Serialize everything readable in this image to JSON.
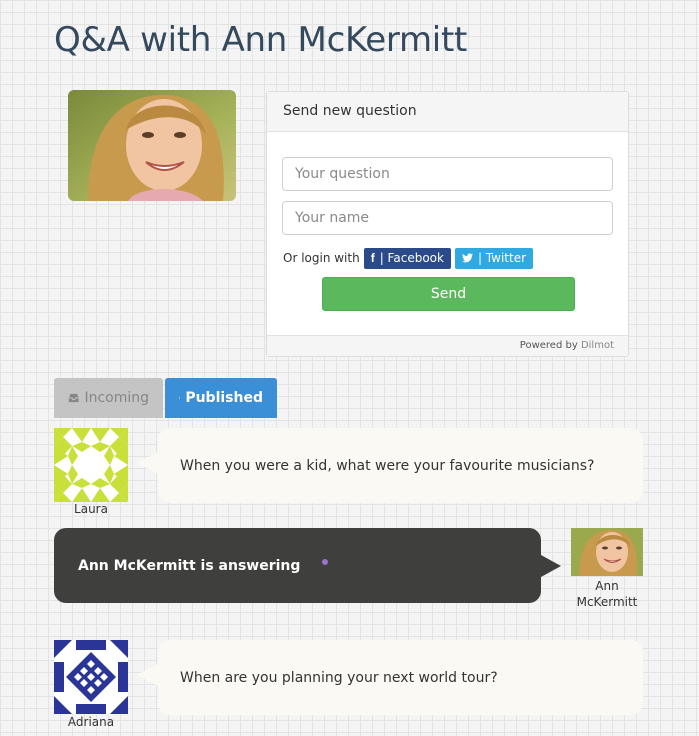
{
  "page": {
    "title": "Q&A with Ann McKermitt"
  },
  "form": {
    "header": "Send new question",
    "question_placeholder": "Your question",
    "name_placeholder": "Your name",
    "login_prefix": "Or login with",
    "facebook_label": "| Facebook",
    "twitter_label": "| Twitter",
    "send_label": "Send",
    "footer_prefix": "Powered by",
    "footer_brand": "Dilmot"
  },
  "tabs": [
    {
      "label": "Incoming",
      "icon": "inbox-icon",
      "active": false
    },
    {
      "label": "Published",
      "icon": "globe-icon",
      "active": true
    }
  ],
  "questions": [
    {
      "author": "Laura",
      "text": "When you were a kid, what were your favourite musicians?"
    },
    {
      "author": "Adriana",
      "text": "When are you planning your next world tour?"
    }
  ],
  "answering": {
    "text": "Ann McKermitt is answering",
    "name_line1": "Ann",
    "name_line2": "McKermitt"
  },
  "colors": {
    "send": "#5cb85c",
    "facebook": "#2a4a8a",
    "twitter": "#2fa9e0",
    "tab_active": "#3b8fd6",
    "tab_inactive": "#c4c4c4",
    "answer_bubble": "#3f3f3d"
  }
}
